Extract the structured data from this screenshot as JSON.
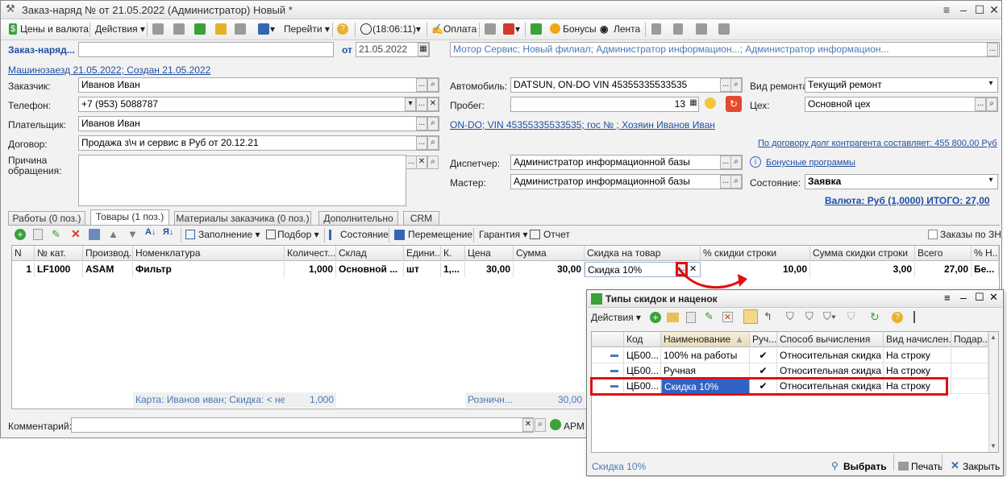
{
  "window": {
    "title": "Заказ-наряд №  от 21.05.2022 (Администратор) Новый *"
  },
  "toolbar": {
    "prices": "Цены и валюта",
    "actions": "Действия",
    "goto": "Перейти",
    "time": "(18:06:11)",
    "payment": "Оплата",
    "bonuses": "Бонусы",
    "tape": "Лента"
  },
  "header": {
    "order_label": "Заказ-наряд...",
    "order_number": "",
    "date_from_label": "от",
    "date": "21.05.2022",
    "org": "Мотор Сервис; Новый филиал; Администратор информацион...; Администратор информацион...",
    "arrival_link": "Машинозаезд 21.05.2022; Создан 21.05.2022"
  },
  "form": {
    "customer_label": "Заказчик:",
    "customer": "Иванов Иван",
    "phone_label": "Телефон:",
    "phone": "+7 (953) 5088787",
    "payer_label": "Плательщик:",
    "payer": "Иванов Иван",
    "contract_label": "Договор:",
    "contract": "Продажа з\\ч и сервис в Руб от 20.12.21",
    "reason_label": "Причина обращения:",
    "car_label": "Автомобиль:",
    "car": "DATSUN, ON-DO VIN 45355335533535",
    "mileage_label": "Пробег:",
    "mileage": "13",
    "car_link": "ON-DO; VIN 45355335533535; гос № ; Хозяин Иванов Иван",
    "debt_link": "По договору долг контрагента составляет: 455 800,00 Руб",
    "dispatcher_label": "Диспетчер:",
    "dispatcher": "Администратор информационной базы",
    "master_label": "Мастер:",
    "master": "Администратор информационной базы",
    "repair_label": "Вид ремонта:",
    "repair": "Текущий ремонт",
    "shop_label": "Цех:",
    "shop": "Основной цех",
    "bonus_link": "Бонусные программы",
    "state_label": "Состояние:",
    "state": "Заявка",
    "total_link": "Валюта: Руб (1,0000) ИТОГО: 27,00"
  },
  "tabs": [
    "Работы (0 поз.)",
    "Товары (1 поз.)",
    "Материалы заказчика (0 поз.)",
    "Дополнительно",
    "CRM"
  ],
  "grid_toolbar": {
    "fill": "Заполнение",
    "pick": "Подбор",
    "state": "Состояние",
    "move": "Перемещение",
    "warranty": "Гарантия",
    "report": "Отчет",
    "orders_checkbox": "Заказы по ЗН"
  },
  "grid": {
    "headers": [
      "N",
      "№ кат.",
      "Производ...",
      "Номенклатура",
      "Количест...",
      "Склад",
      "Едини...",
      "К.",
      "Цена",
      "Сумма",
      "Скидка на товар",
      "% скидки строки",
      "Сумма скидки строки",
      "Всего",
      "% Н..."
    ],
    "row": [
      "1",
      "LF1000",
      "ASAM",
      "Фильтр",
      "1,000",
      "Основной ...",
      "шт",
      "1,...",
      "30,00",
      "30,00",
      "Скидка 10%",
      "10,00",
      "3,00",
      "27,00",
      "Бе..."
    ],
    "footer": {
      "card": "Карта: Иванов иван; Скидка:  < не...",
      "qty": "1,000",
      "retail": "Розничн...",
      "sum": "30,00"
    }
  },
  "comment_label": "Комментарий:",
  "arm_label": "АРМ",
  "popup": {
    "title": "Типы скидок и наценок",
    "actions": "Действия",
    "headers": [
      "Код",
      "Наименование",
      "Руч...",
      "Способ вычисления",
      "Вид начислен...",
      "Подар..."
    ],
    "rows": [
      [
        "ЦБ00...",
        "100% на работы",
        "✔",
        "Относительная скидка",
        "На строку"
      ],
      [
        "ЦБ00...",
        "Ручная",
        "✔",
        "Относительная скидка",
        "На строку"
      ],
      [
        "ЦБ00...",
        "Скидка 10%",
        "✔",
        "Относительная скидка",
        "На строку"
      ]
    ],
    "status": "Скидка 10%",
    "select": "Выбрать",
    "print": "Печать",
    "close": "Закрыть"
  },
  "colors": {
    "accent_red": "#e01010",
    "link": "#1f4fa3",
    "selected_row": "#3163c5"
  }
}
